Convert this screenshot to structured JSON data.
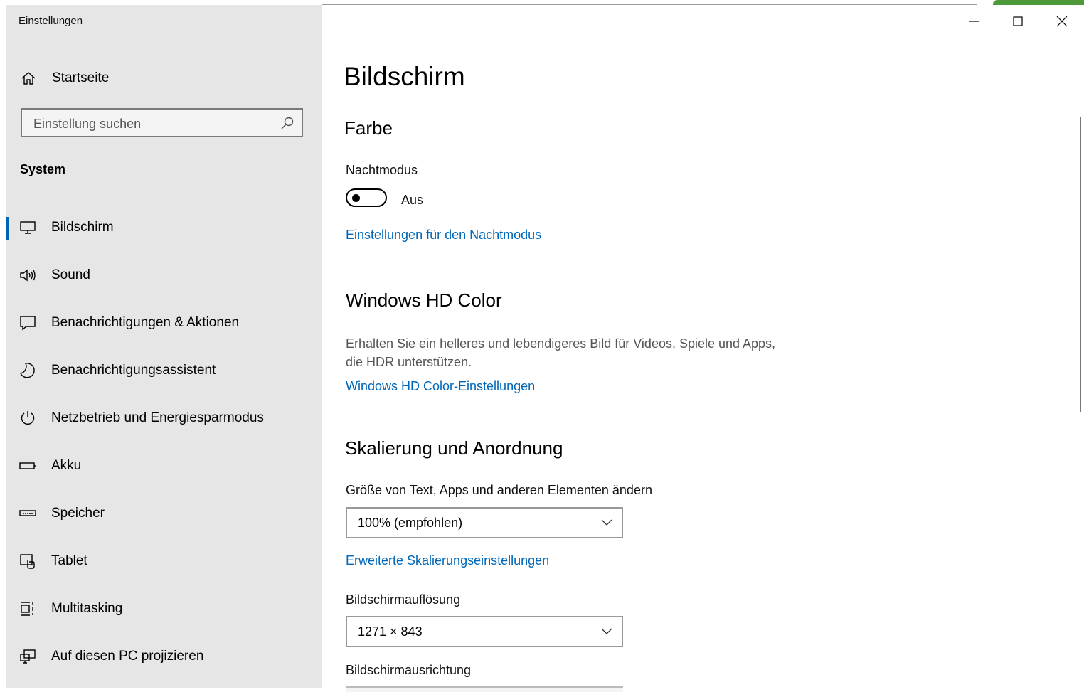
{
  "window": {
    "title": "Einstellungen"
  },
  "sidebar": {
    "home_label": "Startseite",
    "search_placeholder": "Einstellung suchen",
    "section": "System",
    "items": [
      {
        "label": "Bildschirm",
        "icon": "monitor-icon",
        "active": true
      },
      {
        "label": "Sound",
        "icon": "speaker-icon"
      },
      {
        "label": "Benachrichtigungen & Aktionen",
        "icon": "notification-icon"
      },
      {
        "label": "Benachrichtigungsassistent",
        "icon": "moon-icon"
      },
      {
        "label": "Netzbetrieb und Energiesparmodus",
        "icon": "power-icon"
      },
      {
        "label": "Akku",
        "icon": "battery-icon"
      },
      {
        "label": "Speicher",
        "icon": "storage-icon"
      },
      {
        "label": "Tablet",
        "icon": "tablet-icon"
      },
      {
        "label": "Multitasking",
        "icon": "multitasking-icon"
      },
      {
        "label": "Auf diesen PC projizieren",
        "icon": "project-icon"
      }
    ]
  },
  "main": {
    "title": "Bildschirm",
    "color_section": {
      "heading": "Farbe",
      "night_mode_label": "Nachtmodus",
      "night_mode_state": "Aus",
      "night_mode_link": "Einstellungen für den Nachtmodus"
    },
    "hdr_section": {
      "heading": "Windows HD Color",
      "description": "Erhalten Sie ein helleres und lebendigeres Bild für Videos, Spiele und Apps, die HDR unterstützen.",
      "link": "Windows HD Color-Einstellungen"
    },
    "scaling_section": {
      "heading": "Skalierung und Anordnung",
      "scale_label": "Größe von Text, Apps und anderen Elementen ändern",
      "scale_value": "100% (empfohlen)",
      "scale_link": "Erweiterte Skalierungseinstellungen",
      "resolution_label": "Bildschirmauflösung",
      "resolution_value": "1271 × 843",
      "orientation_label": "Bildschirmausrichtung"
    }
  },
  "colors": {
    "accent": "#0067b8",
    "sidebar_bg": "#e6e6e6",
    "active_indicator": "#0063b1"
  }
}
